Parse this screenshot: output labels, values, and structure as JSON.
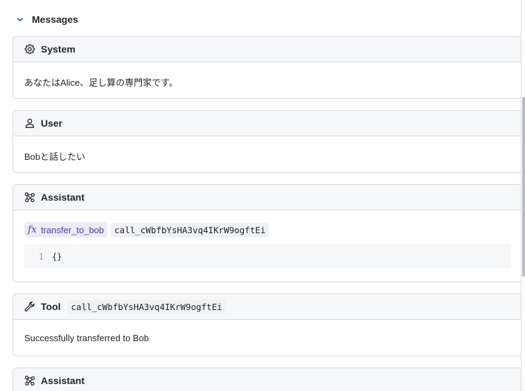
{
  "section": {
    "title": "Messages"
  },
  "messages": [
    {
      "role": "System",
      "icon": "gear-icon",
      "content": "あなたはAlice、足し算の専門家です。"
    },
    {
      "role": "User",
      "icon": "user-icon",
      "content": "Bobと話したい"
    },
    {
      "role": "Assistant",
      "icon": "assistant-icon",
      "tool_call": {
        "fx_symbol": "fx",
        "function_name": "transfer_to_bob",
        "call_id": "call_cWbfbYsHA3vq4IKrW9ogftEi",
        "code_line_number": "1",
        "code_text": "{}"
      }
    },
    {
      "role": "Tool",
      "icon": "wrench-icon",
      "call_id": "call_cWbfbYsHA3vq4IKrW9ogftEi",
      "content": "Successfully transferred to Bob"
    },
    {
      "role": "Assistant",
      "icon": "assistant-icon"
    }
  ]
}
